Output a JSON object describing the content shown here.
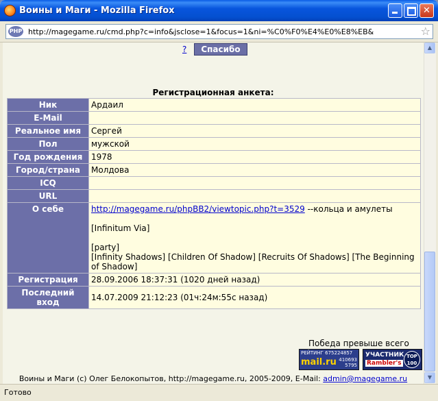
{
  "window": {
    "title": "Воины и Маги - Mozilla Firefox",
    "url": "http://magegame.ru/cmd.php?c=info&jsclose=1&focus=1&ni=%C0%F0%E4%E0%E8%EB&",
    "status": "Готово"
  },
  "toolbar": {
    "help_label": "?",
    "thanks_label": "Спасибо"
  },
  "form": {
    "title": "Регистрационная анкета:",
    "rows": [
      {
        "label": "Ник",
        "value": "Ардаил"
      },
      {
        "label": "E-Mail",
        "value": ""
      },
      {
        "label": "Реальное имя",
        "value": "Сергей"
      },
      {
        "label": "Пол",
        "value": "мужской"
      },
      {
        "label": "Год рождения",
        "value": "1978"
      },
      {
        "label": "Город/страна",
        "value": "Молдова"
      },
      {
        "label": "ICQ",
        "value": ""
      },
      {
        "label": "URL",
        "value": ""
      }
    ],
    "about": {
      "label": "О себе",
      "link": "http://magegame.ru/phpBB2/viewtopic.php?t=3529",
      "link_suffix": " --кольца и амулеты",
      "line2": "[Infinitum Via]",
      "line3": "[party]",
      "line4": "[Infinity Shadows] [Children Of Shadow] [Recruits Of Shadows] [The Beginning of Shadow]"
    },
    "registration": {
      "label": "Регистрация",
      "value": "28.09.2006 18:37:31 (1020 дней назад)"
    },
    "last_login": {
      "label": "Последний вход",
      "value": "14.07.2009 21:12:23 (01ч:24м:55с назад)"
    }
  },
  "motto": "Победа превыше всего",
  "badges": {
    "mail_rating_label": "РЕЙТИНГ 675224857",
    "mail_logo": "mail.ru",
    "mail_count1": "410693",
    "mail_count2": "5795",
    "rambler_label": "УЧАСТНИК",
    "rambler_logo": "Rambler's",
    "rambler_top": "TOP 100"
  },
  "footer": {
    "text": "Воины и Маги (c) Олег Белокопытов, http://magegame.ru, 2005-2009, E-Mail: ",
    "email": "admin@magegame.ru"
  }
}
